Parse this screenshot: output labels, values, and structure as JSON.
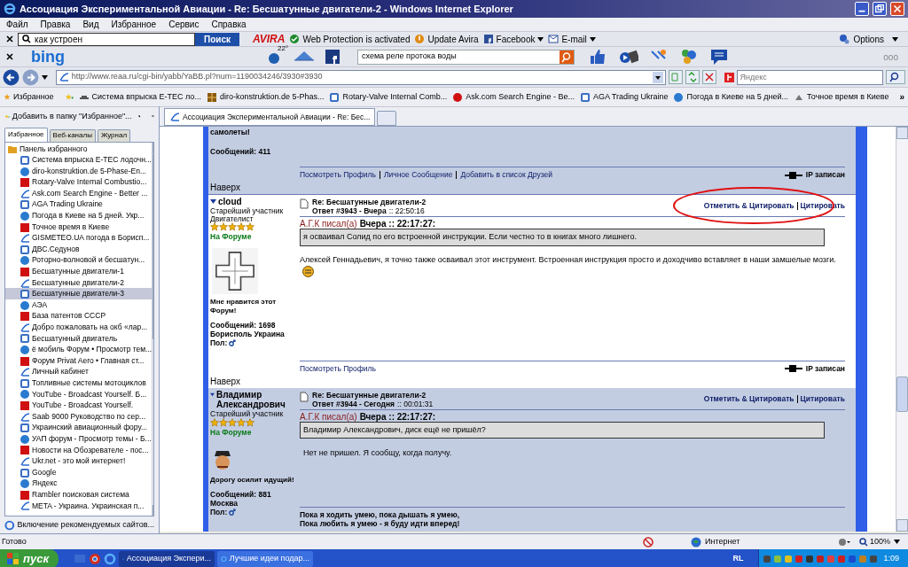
{
  "window": {
    "title": "Ассоциация Экспериментальной Авиации - Re: Бесшатунные двигатели-2 - Windows Internet Explorer"
  },
  "menu": [
    "Файл",
    "Правка",
    "Вид",
    "Избранное",
    "Сервис",
    "Справка"
  ],
  "avira_toolbar": {
    "search_value": "как устроен",
    "search_button": "Поиск",
    "brand": "AVIRA",
    "items": [
      "Web Protection is activated",
      "Update Avira",
      "Facebook",
      "E-mail"
    ],
    "options": "Options"
  },
  "bing_toolbar": {
    "brand": "bing",
    "badge": "22°",
    "search_value": "схема реле протока воды",
    "more": "ooo"
  },
  "address_bar": {
    "url": "http://www.reaa.ru/cgi-bin/yabb/YaBB.pl?num=1190034246/3930#3930",
    "search_placeholder": "Яндекс"
  },
  "favorites_bar": {
    "label": "Избранное",
    "items": [
      "Система впрыска E-TEC ло...",
      "diro-konstruktion.de 5-Phas...",
      "Rotary-Valve Internal Comb...",
      "Ask.com Search Engine - Be...",
      "AGA Trading Ukraine",
      "Погода в Киеве на 5 дней...",
      "Точное время в Киеве"
    ],
    "more": "»"
  },
  "sidebar": {
    "add_label": "Добавить в папку \"Избранное\"...",
    "tabs": [
      {
        "label": "Избранное",
        "selected": true
      },
      {
        "label": "Веб-каналы",
        "selected": false
      },
      {
        "label": "Журнал",
        "selected": false
      }
    ],
    "folder": "Панель избранного",
    "items": [
      {
        "label": "Система впрыска E-TEC лодочн...",
        "selected": false
      },
      {
        "label": "diro-konstruktion.de 5-Phase-En...",
        "selected": false
      },
      {
        "label": "Rotary-Valve Internal Combustio...",
        "selected": false
      },
      {
        "label": "Ask.com Search Engine - Better ...",
        "selected": false
      },
      {
        "label": "AGA Trading Ukraine",
        "selected": false
      },
      {
        "label": "Погода в Киеве на 5 дней. Укр...",
        "selected": false
      },
      {
        "label": "Точное время в Киеве",
        "selected": false
      },
      {
        "label": "GISMETEO.UA погода в Борисп...",
        "selected": false
      },
      {
        "label": "ДВС.Седунов",
        "selected": false
      },
      {
        "label": "Роторно-волновой и бесшатун...",
        "selected": false
      },
      {
        "label": "Бесшатунные двигатели-1",
        "selected": false
      },
      {
        "label": "Бесшатунные двигатели-2",
        "selected": false
      },
      {
        "label": "Бесшатунные двигатели-3",
        "selected": true
      },
      {
        "label": "АЭА",
        "selected": false
      },
      {
        "label": "База патентов СССР",
        "selected": false
      },
      {
        "label": "Добро пожаловать на окб «лар...",
        "selected": false
      },
      {
        "label": "Бесшатунный двигатель",
        "selected": false
      },
      {
        "label": "ё мобиль Форум • Просмотр тем...",
        "selected": false
      },
      {
        "label": "Форум Privat Aero • Главная ст...",
        "selected": false
      },
      {
        "label": "Личный кабинет",
        "selected": false
      },
      {
        "label": "Топливные системы мотоциклов",
        "selected": false
      },
      {
        "label": "YouTube - Broadcast Yourself. Б...",
        "selected": false
      },
      {
        "label": "YouTube - Broadcast Yourself.",
        "selected": false
      },
      {
        "label": "Saab 9000 Руководство по сер...",
        "selected": false
      },
      {
        "label": "Украинский авиационный фору...",
        "selected": false
      },
      {
        "label": "УАП форум - Просмотр темы - Б...",
        "selected": false
      },
      {
        "label": "Новости на Обозревателе - пос...",
        "selected": false
      },
      {
        "label": "Ukr.net - это мой интернет!",
        "selected": false
      },
      {
        "label": "Google",
        "selected": false
      },
      {
        "label": "Яндекс",
        "selected": false
      },
      {
        "label": "Rambler поисковая система",
        "selected": false
      },
      {
        "label": "META - Украина. Украинская п...",
        "selected": false
      }
    ],
    "footer": "Включение рекомендуемых сайтов..."
  },
  "tabs": [
    {
      "label": "Ассоциация Экспериментальной Авиации - Re: Бес...",
      "selected": true
    }
  ],
  "posts": [
    {
      "kind": "tail",
      "signature": "самолеты!",
      "count": "Сообщений: 411",
      "links": [
        "Посмотреть Профиль",
        "Личное Сообщение",
        "Добавить в список Друзей"
      ],
      "ip": "IP записан",
      "top_link": "Наверх"
    },
    {
      "kind": "post",
      "shaded": false,
      "circled": true,
      "author": "cloud",
      "rank": "Старейший участник",
      "title": "Двигателист",
      "stars": 5,
      "online": "На Форуме",
      "avatar": {
        "kind": "drawing"
      },
      "personal": "Мне нравится этот Форум!",
      "count": "Сообщений: 1698",
      "location": "Борисполь Украина",
      "gender": "Пол:",
      "subject": "Re: Бесшатунные двигатели-2",
      "reply": "Ответ #3943 - Вчера",
      "time": ":: 22:50:16",
      "actions": [
        "Отметить & Цитировать",
        "Цитировать"
      ],
      "quote_author": "А.Г.К писал(а)",
      "quote_date": "Вчера :: 22:17:27:",
      "quote": "я осваивал Солид по его встроенной инструкции. Если честно то в книгах много лишнего.",
      "body": "Алексей Геннадьевич, я точно также осваивал этот инструмент. Встроенная инструкция просто и доходчиво вставляет в наши замшелые мозги.",
      "smiley": true,
      "links": [
        "Посмотреть Профиль"
      ],
      "ip": "IP записан",
      "top_link": "Наверх"
    },
    {
      "kind": "post",
      "shaded": true,
      "circled": false,
      "author": "Владимир Александрович",
      "rank": "Старейший участник",
      "stars": 5,
      "online": "На Форуме",
      "avatar": {
        "kind": "cartoon"
      },
      "personal": "Дорогу осилит идущий!",
      "count": "Сообщений: 881",
      "location": "Москва",
      "gender": "Пол:",
      "subject": "Re: Бесшатунные двигатели-2",
      "reply": "Ответ #3944 - Сегодня",
      "time": ":: 00:01:31",
      "actions": [
        "Отметить & Цитировать",
        "Цитировать"
      ],
      "quote_author": "А.Г.К писал(а)",
      "quote_date": "Вчера :: 22:17:27:",
      "quote": "Владимир Александрович, диск ещё не пришёл?",
      "body": "Нет не пришел. Я сообщу, когда получу.",
      "smiley": false,
      "signature": [
        "Пока я ходить умею, пока дышать я умею,",
        "Пока любить я умею - я буду идти вперед!"
      ]
    }
  ],
  "status_bar": {
    "text": "Готово",
    "zone": "Интернет",
    "zoom": "100%"
  },
  "taskbar": {
    "start": "пуск",
    "tasks": [
      {
        "label": "Ассоциация Экспери...",
        "selected": true
      },
      {
        "label": "Лучшие идеи подар...",
        "selected": false
      }
    ],
    "lang": "RL",
    "clock": "1:09"
  }
}
